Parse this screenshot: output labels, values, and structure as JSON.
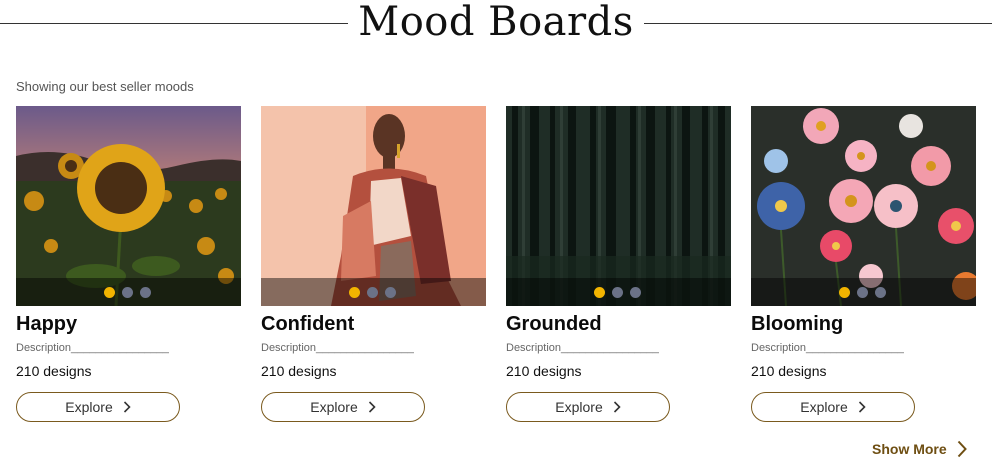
{
  "header": {
    "title": "Mood Boards",
    "subtitle": "Showing our best seller moods"
  },
  "cards": [
    {
      "title": "Happy",
      "description": "Description________________",
      "count": "210 designs",
      "button": "Explore",
      "image": "sunflower-field",
      "active_dot": 1
    },
    {
      "title": "Confident",
      "description": "Description________________",
      "count": "210 designs",
      "button": "Explore",
      "image": "illustrated-woman",
      "active_dot": 1
    },
    {
      "title": "Grounded",
      "description": "Description________________",
      "count": "210 designs",
      "button": "Explore",
      "image": "dark-forest",
      "active_dot": 1
    },
    {
      "title": "Blooming",
      "description": "Description________________",
      "count": "210 designs",
      "button": "Explore",
      "image": "flower-bouquet",
      "active_dot": 1
    }
  ],
  "show_more": "Show More",
  "colors": {
    "accent": "#f2b400",
    "inactive_dot": "#6b7287",
    "button_border": "#7a5a1e",
    "show_more": "#6e4e12"
  }
}
